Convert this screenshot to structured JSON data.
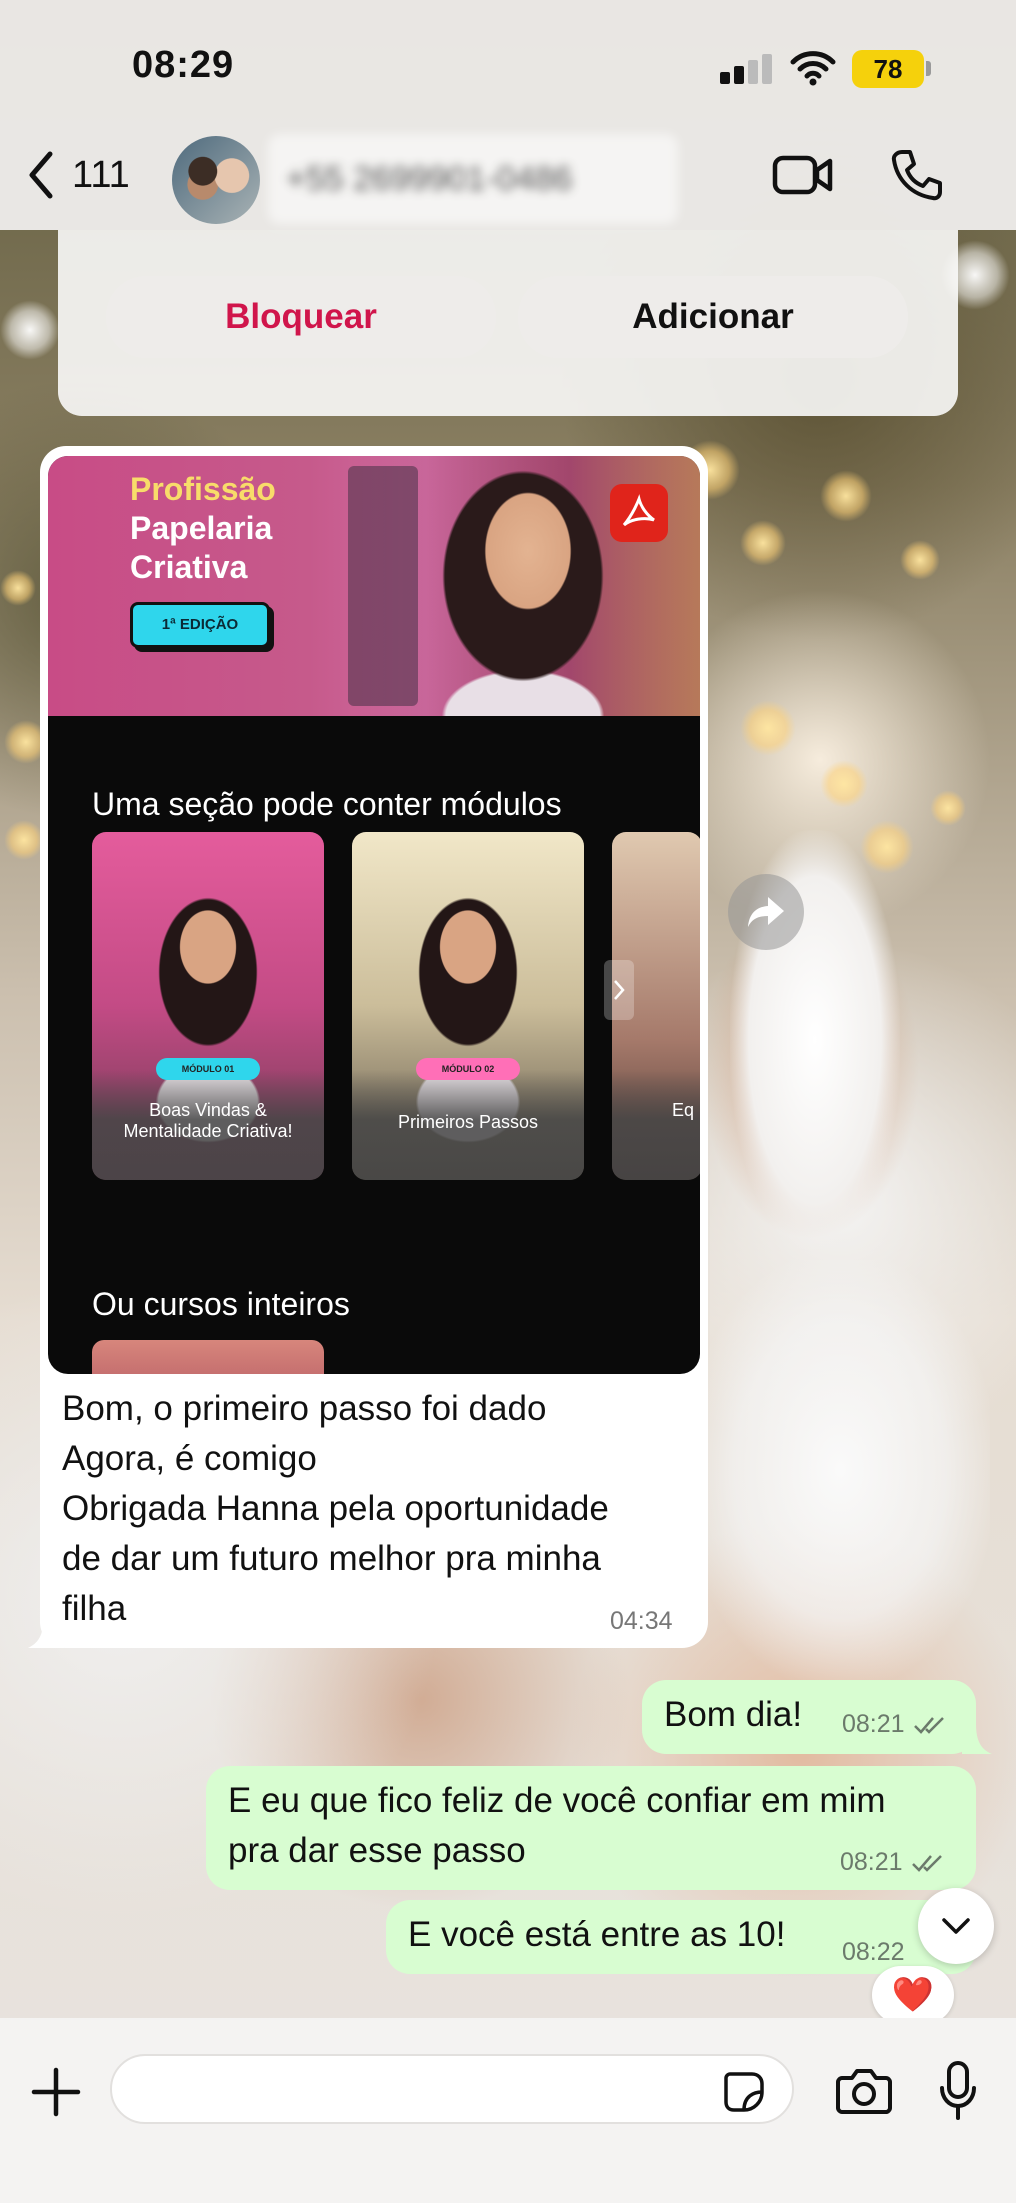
{
  "status_bar": {
    "time": "08:29",
    "battery": "78",
    "battery_color": "#f5d10c"
  },
  "header": {
    "back_count": "111",
    "contact_name": "+55 2699901-0486",
    "icons": [
      "chevron-left-icon",
      "video-camera-icon",
      "phone-icon"
    ]
  },
  "contact_actions": {
    "block_label": "Bloquear",
    "add_label": "Adicionar",
    "block_color": "#d0154b"
  },
  "incoming_message": {
    "promo": {
      "title_line1": "Profissão",
      "title_line2": "Papelaria",
      "title_line3": "Criativa",
      "edition": "1ª EDIÇÃO",
      "section_modules": "Uma seção pode conter módulos",
      "modules": [
        {
          "tag": "MÓDULO 01",
          "name": "Boas Vindas & Mentalidade Criativa!"
        },
        {
          "tag": "MÓDULO 02",
          "name": "Primeiros Passos"
        },
        {
          "tag": "",
          "name": "Eq"
        }
      ],
      "section_courses": "Ou cursos inteiros"
    },
    "lines": [
      "Bom, o primeiro passo foi dado",
      "Agora, é comigo",
      "Obrigada Hanna pela oportunidade",
      "de dar um futuro melhor pra minha",
      "filha"
    ],
    "time": "04:34"
  },
  "outgoing_messages": [
    {
      "text": "Bom dia!",
      "time": "08:21"
    },
    {
      "text_line1": "E eu que fico feliz de você confiar em mim",
      "text_line2": "pra dar esse passo",
      "time": "08:21"
    },
    {
      "text": "E você está entre as 10!",
      "time": "08:22",
      "reaction": "❤️"
    }
  ],
  "composer": {
    "input_value": "",
    "icons": [
      "plus-icon",
      "sticker-icon",
      "camera-icon",
      "microphone-icon"
    ]
  },
  "colors": {
    "outgoing_bubble": "#d8fdd1",
    "incoming_bubble": "#ffffff"
  }
}
